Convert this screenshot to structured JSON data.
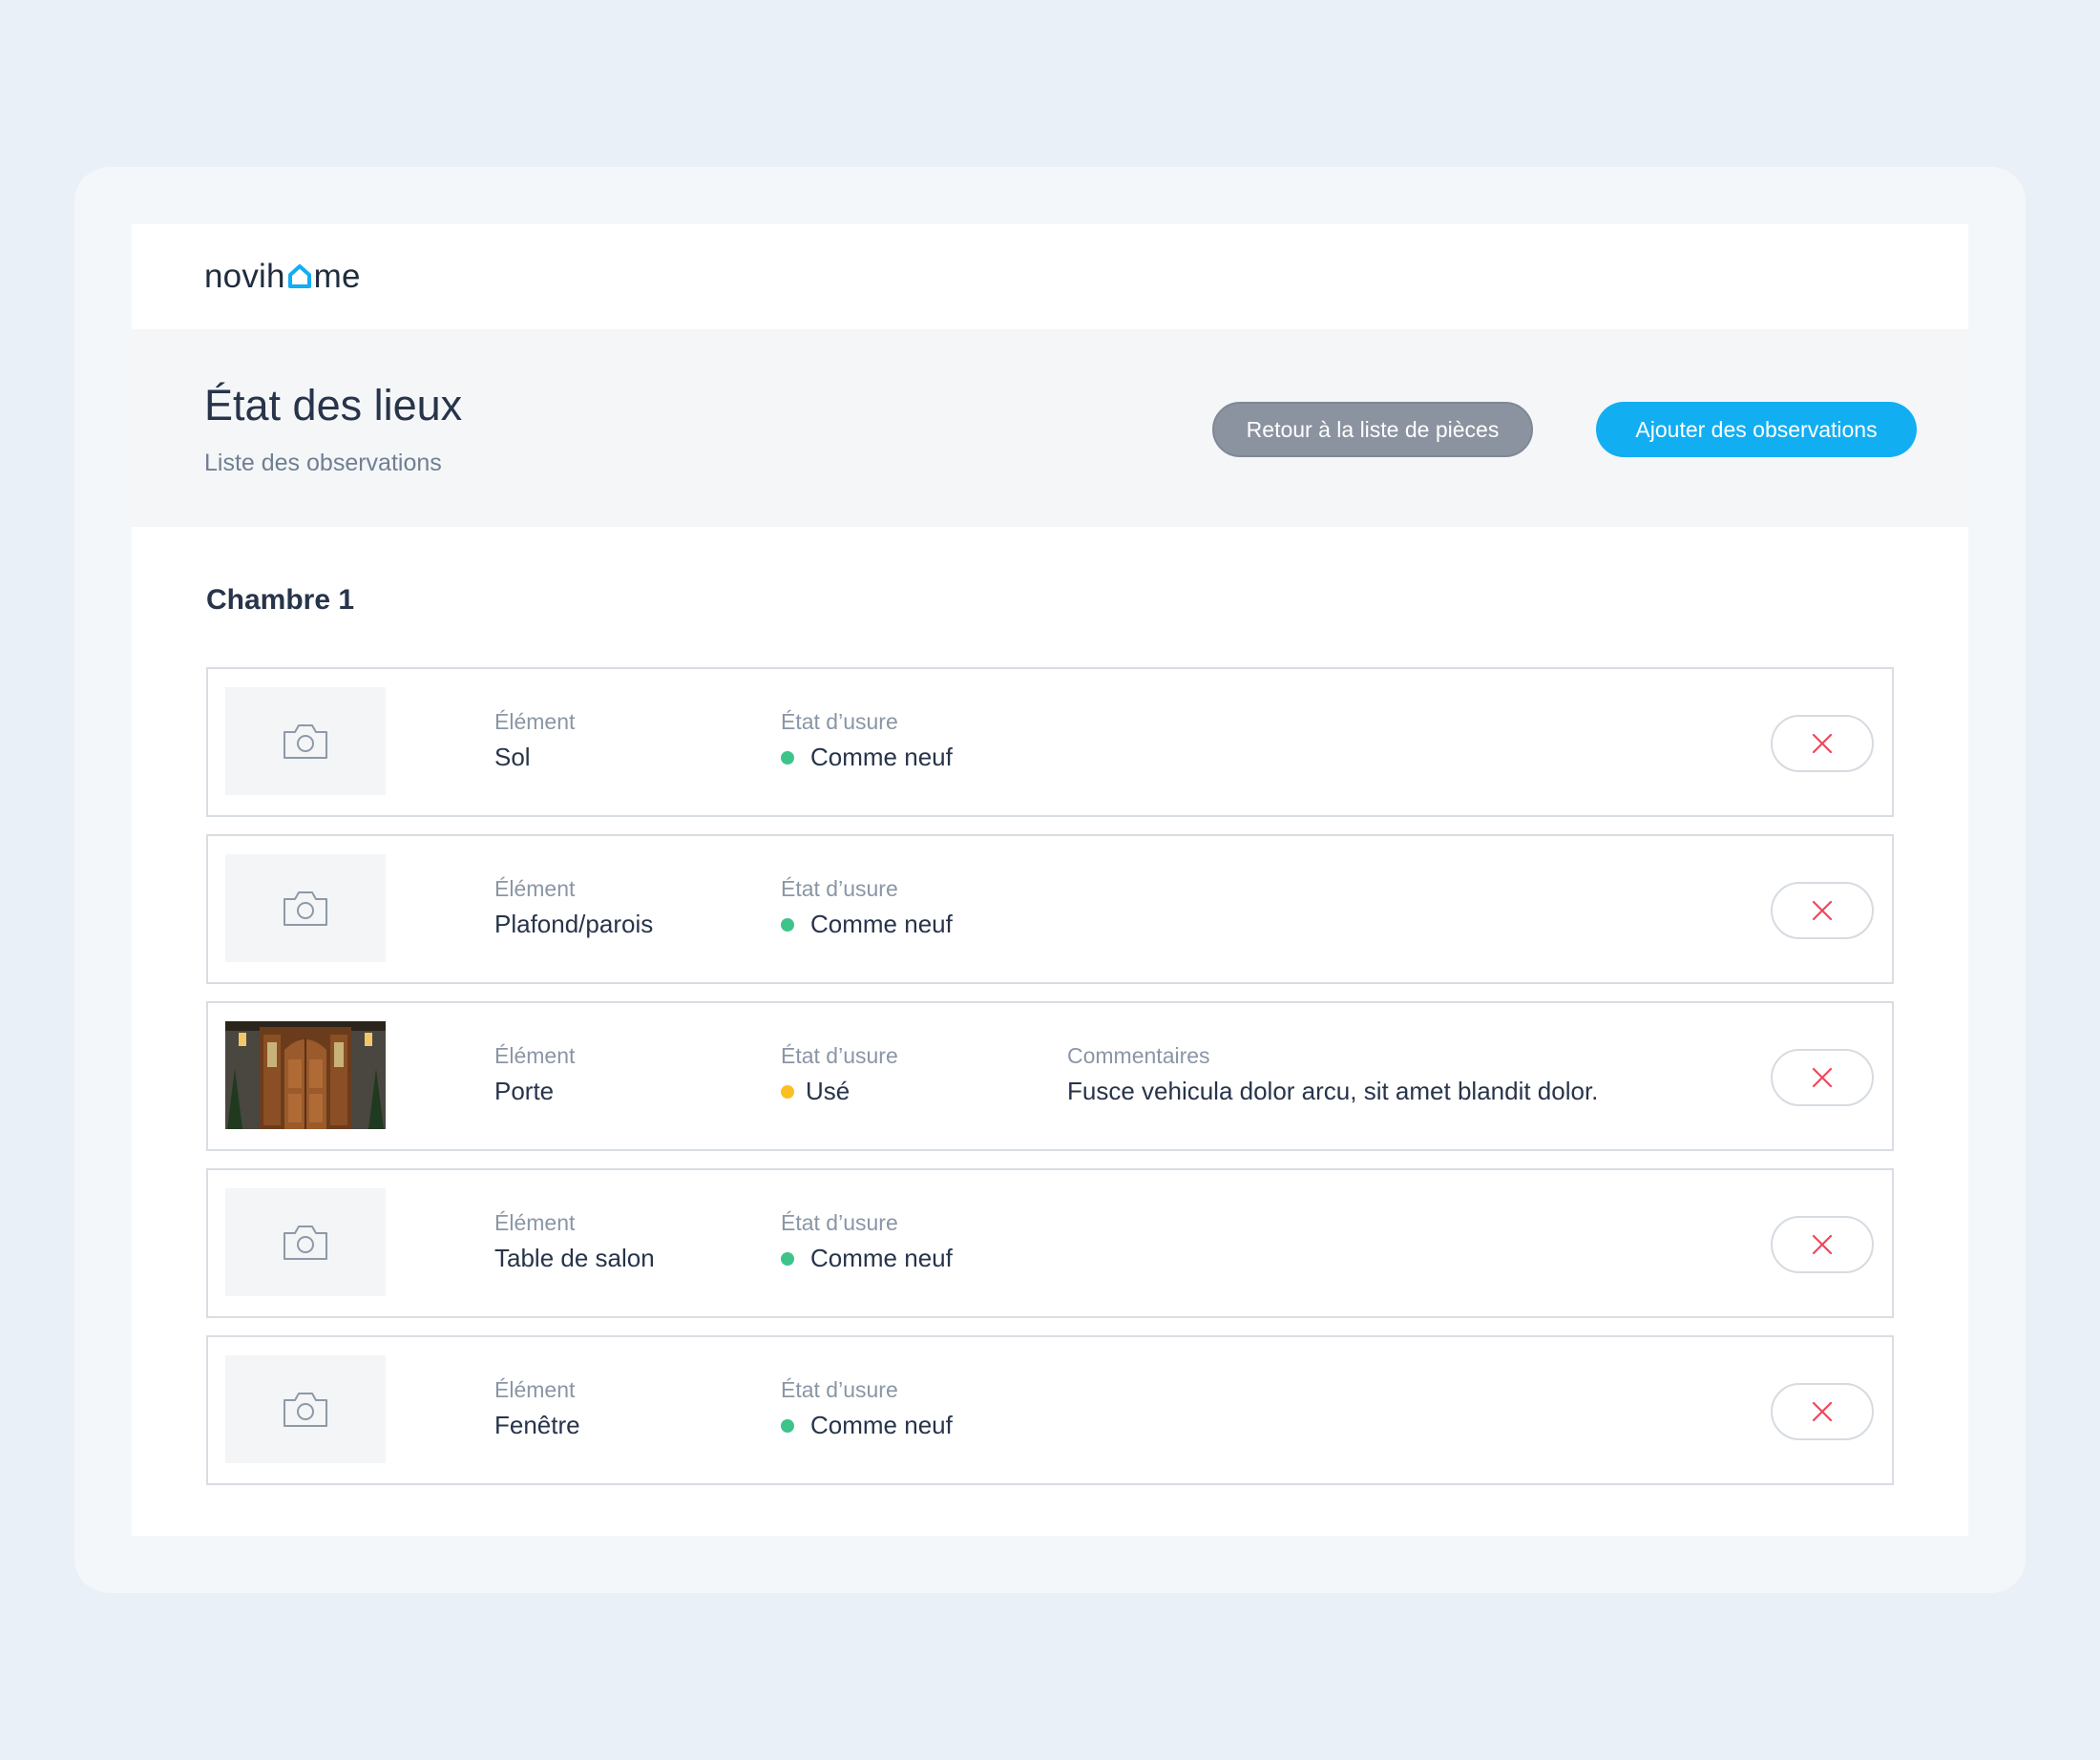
{
  "brand": {
    "logo_prefix": "novih",
    "logo_suffix": "me",
    "accent_color": "#12aef2"
  },
  "header": {
    "title": "État des lieux",
    "subtitle": "Liste des observations",
    "back_button_label": "Retour à la liste de pièces",
    "add_button_label": "Ajouter des observations"
  },
  "room": {
    "name": "Chambre 1"
  },
  "columns": {
    "element_label": "Élément",
    "state_label": "État d’usure",
    "comment_label": "Commentaires"
  },
  "observations": [
    {
      "element": "Sol",
      "state": "Comme neuf",
      "state_color": "#3ec48a",
      "photo": "camera-icon",
      "comment": ""
    },
    {
      "element": "Plafond/parois",
      "state": "Comme neuf",
      "state_color": "#3ec48a",
      "photo": "camera-icon",
      "comment": ""
    },
    {
      "element": "Porte",
      "state": "Usé",
      "state_color": "#fbbf24",
      "photo": "door-photo",
      "comment": "Fusce vehicula dolor arcu, sit amet blandit dolor."
    },
    {
      "element": "Table de salon",
      "state": "Comme neuf",
      "state_color": "#3ec48a",
      "photo": "camera-icon",
      "comment": ""
    },
    {
      "element": "Fenêtre",
      "state": "Comme neuf",
      "state_color": "#3ec48a",
      "photo": "camera-icon",
      "comment": ""
    }
  ]
}
